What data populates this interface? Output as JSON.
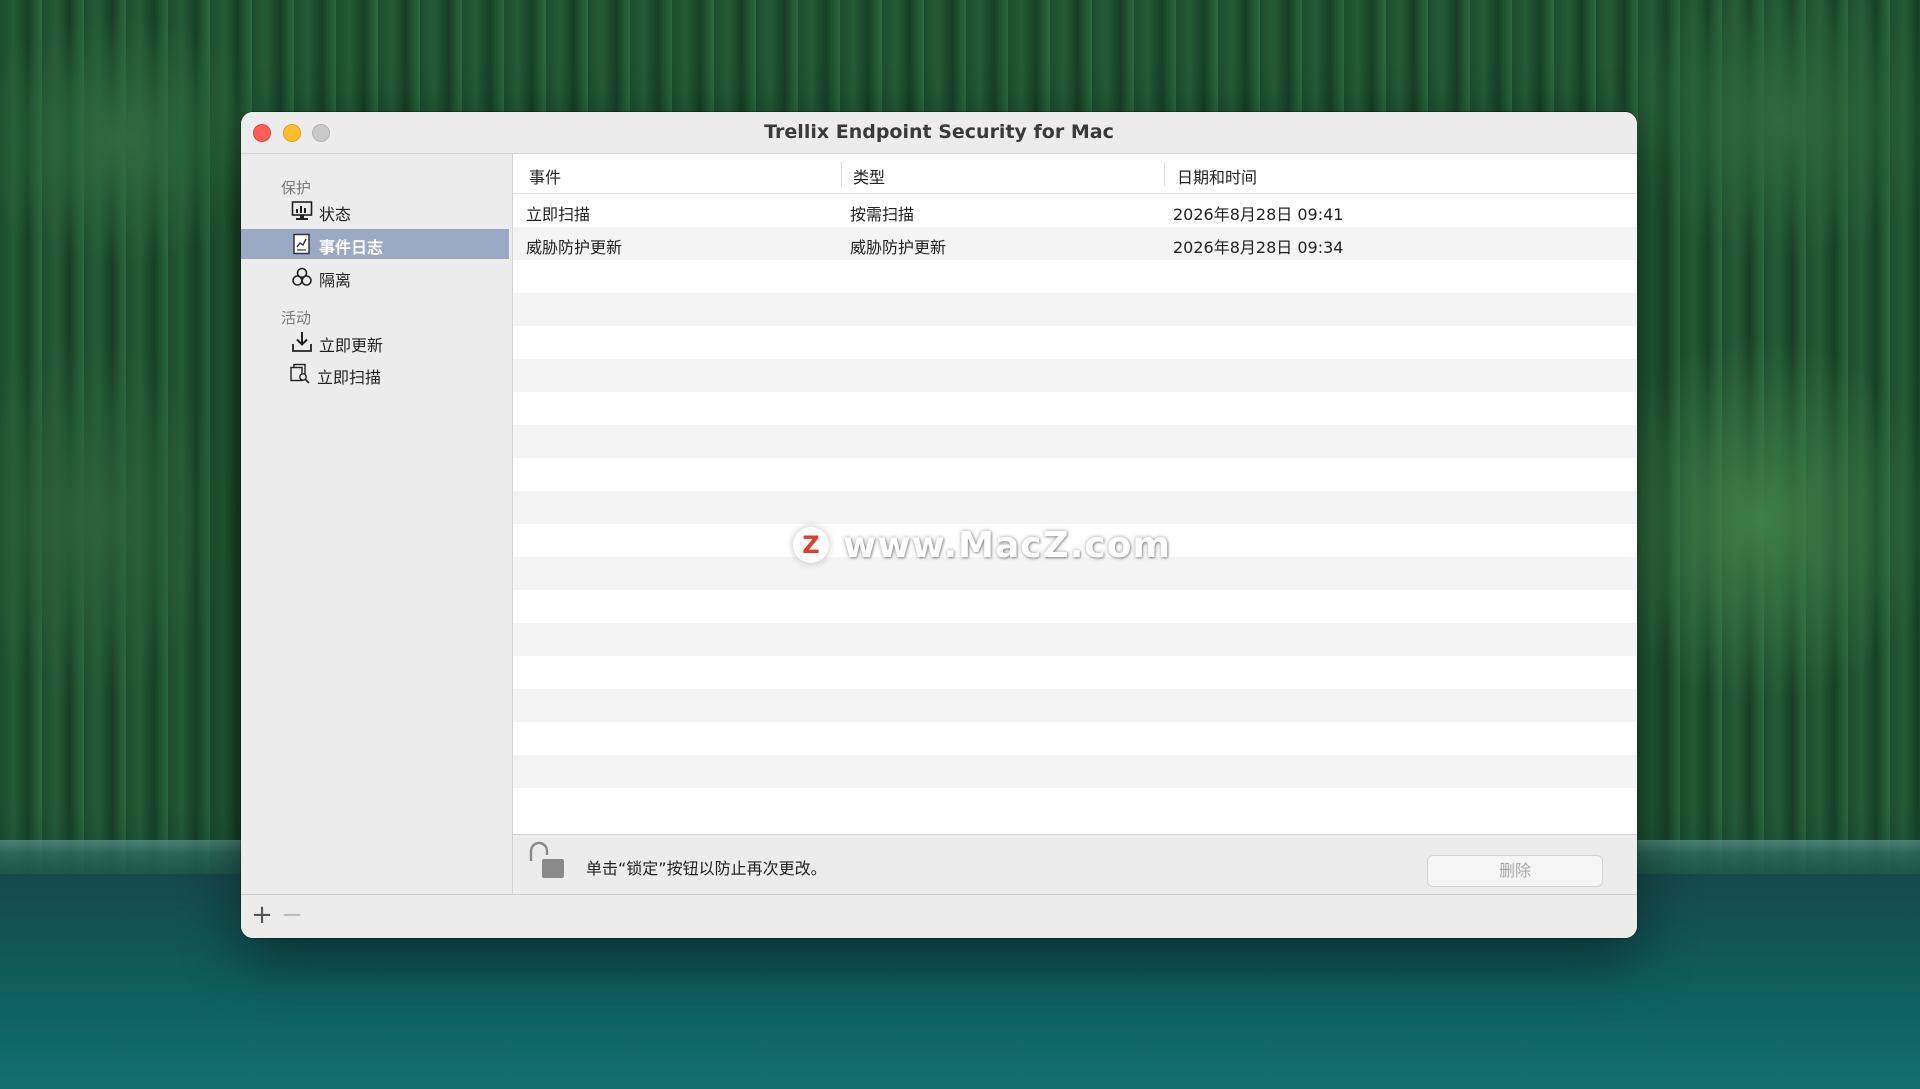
{
  "window": {
    "title": "Trellix Endpoint Security for Mac"
  },
  "sidebar": {
    "sections": [
      {
        "label": "保护",
        "items": [
          {
            "label": "状态",
            "icon": "monitor-icon"
          },
          {
            "label": "事件日志",
            "icon": "event-log-icon",
            "selected": true
          },
          {
            "label": "隔离",
            "icon": "biohazard-icon"
          }
        ]
      },
      {
        "label": "活动",
        "items": [
          {
            "label": "立即更新",
            "icon": "download-icon"
          },
          {
            "label": "立即扫描",
            "icon": "scan-icon"
          }
        ]
      }
    ],
    "selected_color": "#9aa9c4"
  },
  "table": {
    "columns": [
      "事件",
      "类型",
      "日期和时间"
    ],
    "rows": [
      [
        "立即扫描",
        "按需扫描",
        "2026年8月28日 09:41"
      ],
      [
        "威胁防护更新",
        "威胁防护更新",
        "2026年8月28日 09:34"
      ]
    ]
  },
  "lockbar": {
    "text": "单击“锁定”按钮以防止再次更改。",
    "icon": "unlocked-padlock-icon",
    "delete_label": "删除"
  },
  "bottombar": {
    "add_label": "+",
    "remove_label": "−"
  },
  "watermark": {
    "logo_letter": "Z",
    "text": "www.MacZ.com"
  }
}
